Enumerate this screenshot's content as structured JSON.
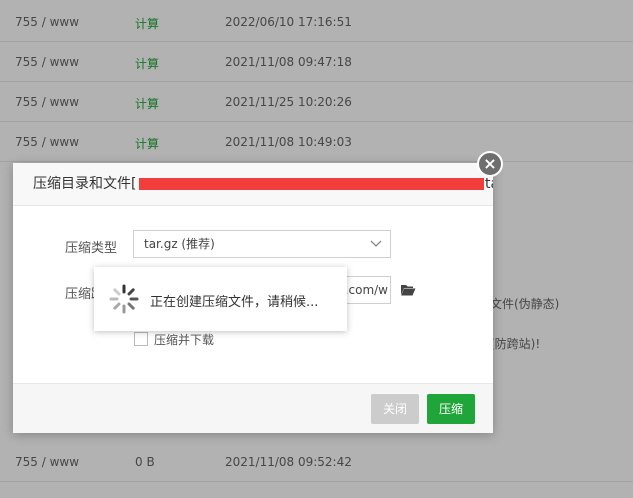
{
  "file_rows": [
    {
      "perm": "755 / www",
      "size": "计算",
      "time": "2022/06/10 17:16:51"
    },
    {
      "perm": "755 / www",
      "size": "计算",
      "time": "2021/11/08 09:47:18"
    },
    {
      "perm": "755 / www",
      "size": "计算",
      "time": "2021/11/25 10:20:26"
    },
    {
      "perm": "755 / www",
      "size": "计算",
      "time": "2021/11/08 10:49:03"
    },
    {
      "perm": "755 / www",
      "size": "0 B",
      "time": "2021/11/08 09:52:42"
    }
  ],
  "aside": {
    "line1": "文件(伪静态)",
    "line2": "(防跨站)!"
  },
  "dialog": {
    "title_prefix": "压缩目录和文件[",
    "title_suffix": "ta",
    "type_label": "压缩类型",
    "type_value": "tar.gz (推荐)",
    "path_label": "压缩路",
    "path_value": "o.com/w",
    "download_label": "压缩并下载",
    "close_button": "关闭",
    "compress_button": "压缩",
    "dismiss_symbol": "×"
  },
  "loading": {
    "message": "正在创建压缩文件，请稍候..."
  }
}
